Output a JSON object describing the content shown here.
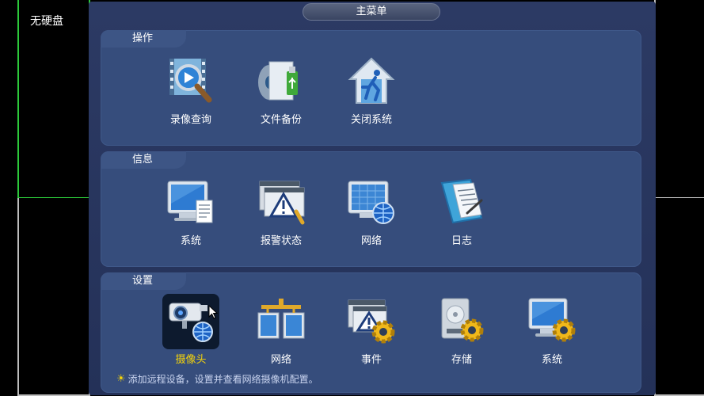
{
  "background": {
    "status_text": "无硬盘"
  },
  "window": {
    "title": "主菜单"
  },
  "sections": {
    "operations": {
      "title": "操作",
      "items": [
        {
          "label": "录像查询",
          "icon": "video-search-icon"
        },
        {
          "label": "文件备份",
          "icon": "file-backup-icon"
        },
        {
          "label": "关闭系统",
          "icon": "shutdown-icon"
        }
      ]
    },
    "info": {
      "title": "信息",
      "items": [
        {
          "label": "系统",
          "icon": "system-info-icon"
        },
        {
          "label": "报警状态",
          "icon": "alarm-status-icon"
        },
        {
          "label": "网络",
          "icon": "network-info-icon"
        },
        {
          "label": "日志",
          "icon": "log-icon"
        }
      ]
    },
    "settings": {
      "title": "设置",
      "items": [
        {
          "label": "摄像头",
          "icon": "camera-icon",
          "selected": true
        },
        {
          "label": "网络",
          "icon": "network-settings-icon"
        },
        {
          "label": "事件",
          "icon": "event-settings-icon"
        },
        {
          "label": "存储",
          "icon": "storage-settings-icon"
        },
        {
          "label": "系统",
          "icon": "system-settings-icon"
        }
      ],
      "hint": "添加远程设备，设置并查看网络摄像机配置。"
    }
  },
  "colors": {
    "selected_label": "#f5d40a",
    "panel": "#364d7c",
    "window": "#2c3a64"
  }
}
